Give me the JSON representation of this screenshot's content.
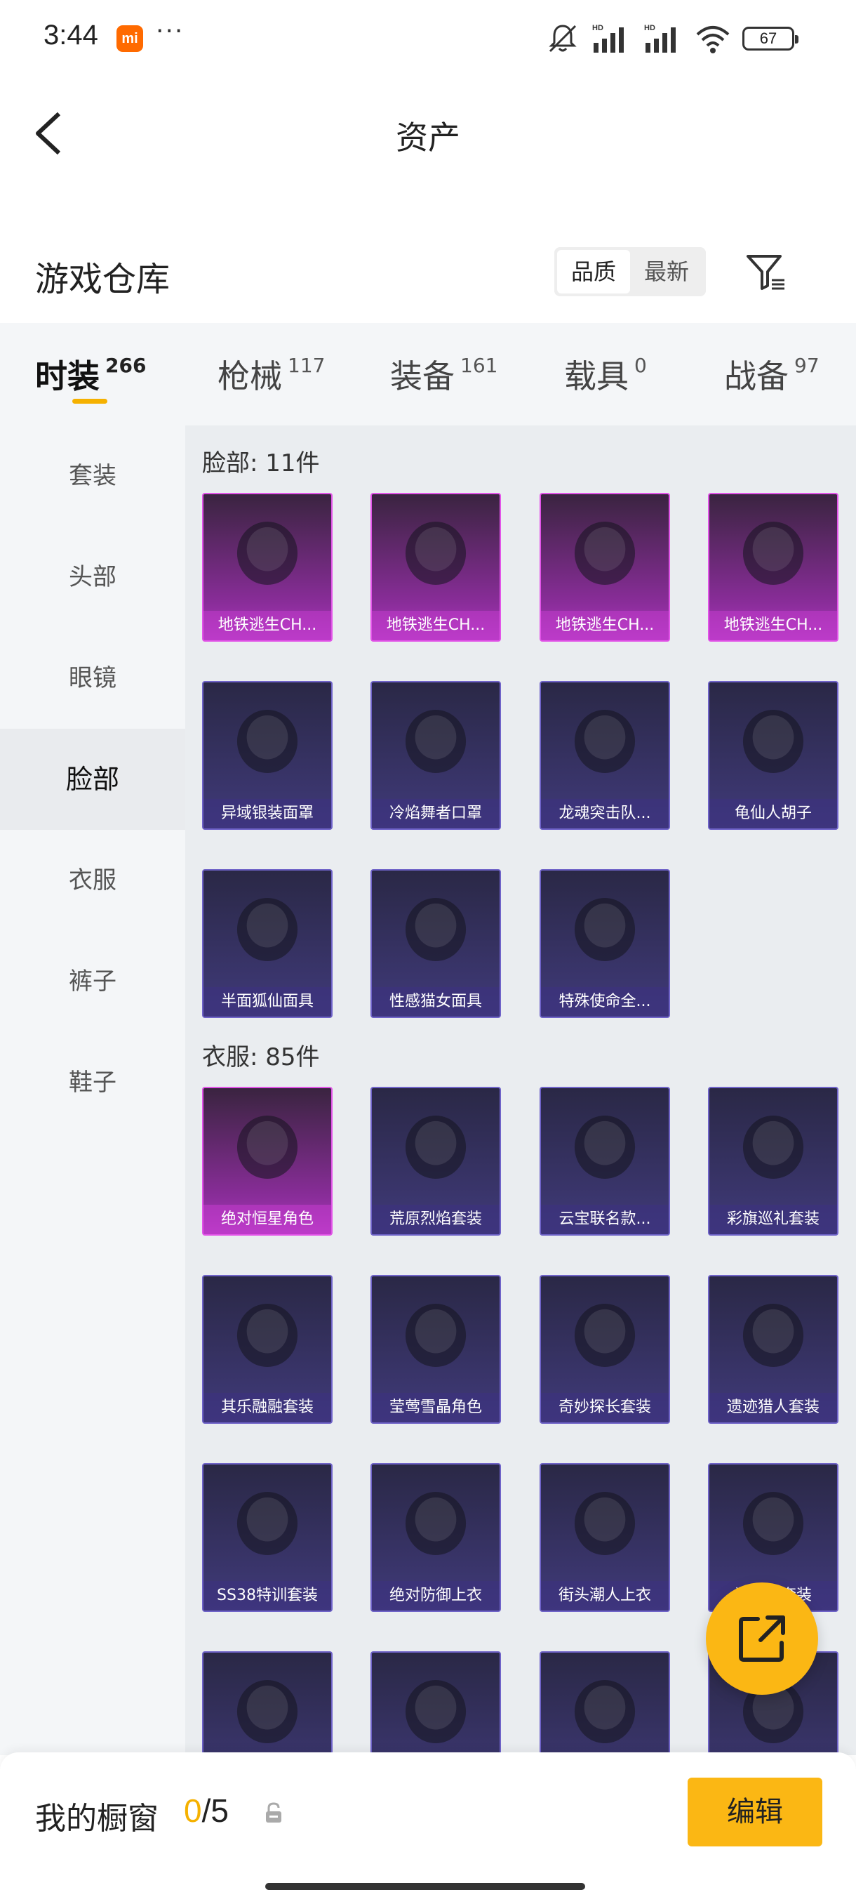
{
  "status": {
    "time": "3:44",
    "battery": "67",
    "mi": "mi",
    "more": "···"
  },
  "header": {
    "title": "资产"
  },
  "warehouse": {
    "title": "游戏仓库",
    "sort_options": [
      "品质",
      "最新"
    ]
  },
  "tabs": [
    {
      "label": "时装",
      "count": "266"
    },
    {
      "label": "枪械",
      "count": "117"
    },
    {
      "label": "装备",
      "count": "161"
    },
    {
      "label": "载具",
      "count": "0"
    },
    {
      "label": "战备",
      "count": "97"
    }
  ],
  "side_nav": [
    "套装",
    "头部",
    "眼镜",
    "脸部",
    "衣服",
    "裤子",
    "鞋子"
  ],
  "sections": [
    {
      "title": "脸部: 11件",
      "items": [
        {
          "name": "地铁逃生CH...",
          "rarity": "purple",
          "icon": "red-scarf-mask"
        },
        {
          "name": "地铁逃生CH...",
          "rarity": "purple",
          "icon": "black-face-mask"
        },
        {
          "name": "地铁逃生CH...",
          "rarity": "purple",
          "icon": "gas-mask"
        },
        {
          "name": "地铁逃生CH...",
          "rarity": "purple",
          "icon": "studded-mask"
        },
        {
          "name": "异域银装面罩",
          "rarity": "blue",
          "icon": "silver-mask"
        },
        {
          "name": "冷焰舞者口罩",
          "rarity": "blue",
          "icon": "flame-mask"
        },
        {
          "name": "龙魂突击队...",
          "rarity": "blue",
          "icon": "dragon-mask"
        },
        {
          "name": "龟仙人胡子",
          "rarity": "blue",
          "icon": "white-beard"
        },
        {
          "name": "半面狐仙面具",
          "rarity": "blue",
          "icon": "fox-mask"
        },
        {
          "name": "性感猫女面具",
          "rarity": "blue",
          "icon": "cat-mask"
        },
        {
          "name": "特殊使命全...",
          "rarity": "blue",
          "icon": "helmet-mask"
        }
      ]
    },
    {
      "title": "衣服: 85件",
      "items": [
        {
          "name": "绝对恒星角色",
          "rarity": "purple",
          "icon": "pink-dress"
        },
        {
          "name": "荒原烈焰套装",
          "rarity": "blue",
          "icon": "red-suit"
        },
        {
          "name": "云宝联名款...",
          "rarity": "blue",
          "icon": "blue-outfit"
        },
        {
          "name": "彩旗巡礼套装",
          "rarity": "blue",
          "icon": "maid-outfit"
        },
        {
          "name": "其乐融融套装",
          "rarity": "blue",
          "icon": "yellow-coat"
        },
        {
          "name": "莹莺雪晶角色",
          "rarity": "blue",
          "icon": "white-character"
        },
        {
          "name": "奇妙探长套装",
          "rarity": "blue",
          "icon": "trench-coat"
        },
        {
          "name": "遗迹猎人套装",
          "rarity": "blue",
          "icon": "hunter-outfit"
        },
        {
          "name": "SS38特训套装",
          "rarity": "blue",
          "icon": "training-outfit"
        },
        {
          "name": "绝对防御上衣",
          "rarity": "blue",
          "icon": "white-jacket"
        },
        {
          "name": "街头潮人上衣",
          "rarity": "blue",
          "icon": "red-puffer"
        },
        {
          "name": "狙击手套装",
          "rarity": "blue",
          "icon": "sniper-outfit"
        },
        {
          "name": "",
          "rarity": "blue",
          "icon": "brown-outfit"
        },
        {
          "name": "",
          "rarity": "blue",
          "icon": "black-jacket"
        },
        {
          "name": "",
          "rarity": "blue",
          "icon": "camo-coat"
        },
        {
          "name": "",
          "rarity": "blue",
          "icon": "orange-outfit"
        }
      ]
    }
  ],
  "bottom_bar": {
    "label": "我的橱窗",
    "current": "0",
    "total": "/5",
    "edit_label": "编辑"
  },
  "colors": {
    "accent": "#fbb714",
    "rare_purple": "#e254e8",
    "rare_blue": "#6f63c8"
  }
}
